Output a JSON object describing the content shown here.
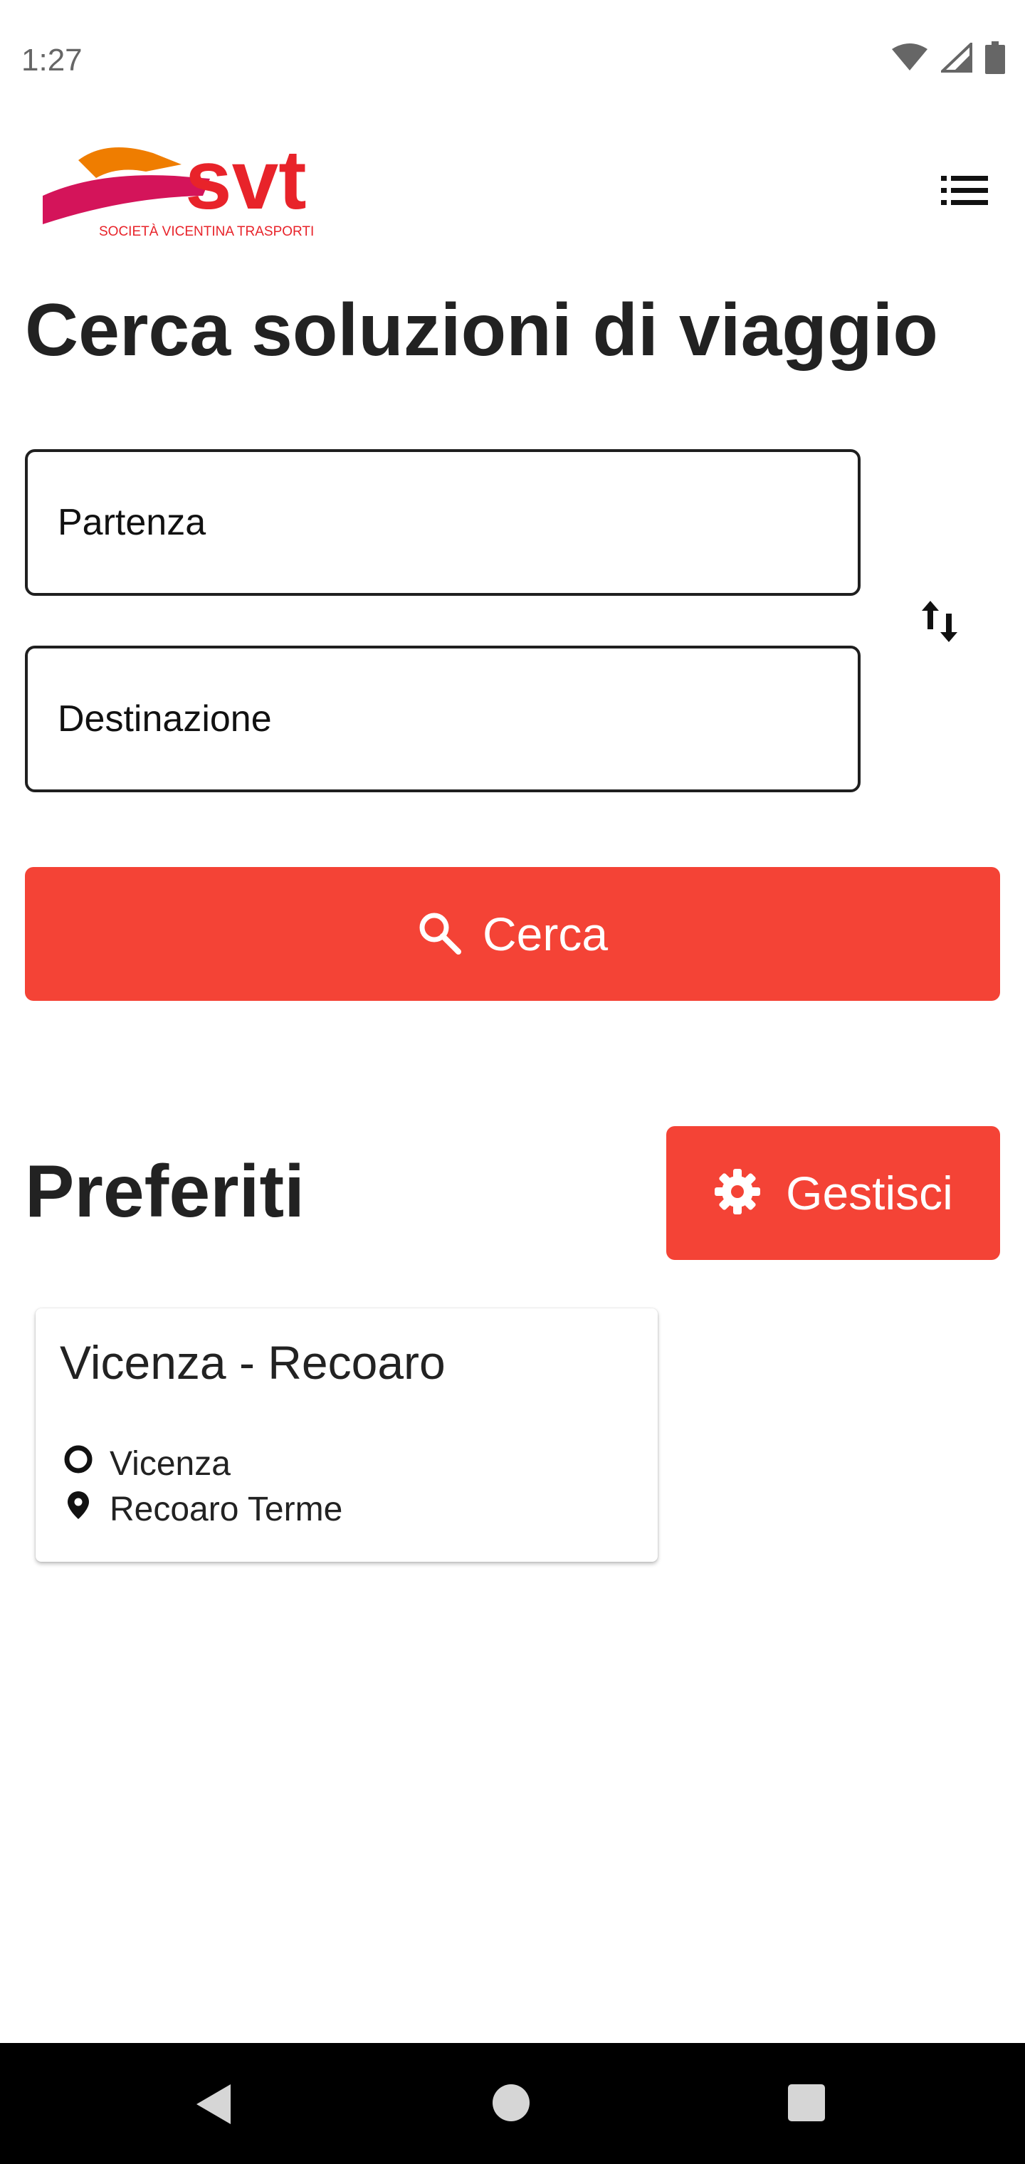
{
  "status_bar": {
    "time": "1:27",
    "icons": [
      "wifi-icon",
      "signal-icon",
      "battery-icon"
    ]
  },
  "header": {
    "logo_text": "svt",
    "logo_subtitle": "SOCIETÀ VICENTINA TRASPORTI",
    "menu_icon": "list-icon"
  },
  "search": {
    "title": "Cerca soluzioni di viaggio",
    "from_placeholder": "Partenza",
    "to_placeholder": "Destinazione",
    "swap_icon": "swap-vertical-icon",
    "button_label": "Cerca",
    "button_icon": "search-icon"
  },
  "favorites": {
    "title": "Preferiti",
    "manage_label": "Gestisci",
    "manage_icon": "gear-icon",
    "items": [
      {
        "name": "Vicenza - Recoaro",
        "from": "Vicenza",
        "to": "Recoaro Terme"
      }
    ]
  },
  "colors": {
    "accent": "#f44336",
    "logo_red": "#e8232a",
    "logo_orange": "#ef7d00",
    "logo_magenta": "#d4145a",
    "text": "#222222"
  }
}
